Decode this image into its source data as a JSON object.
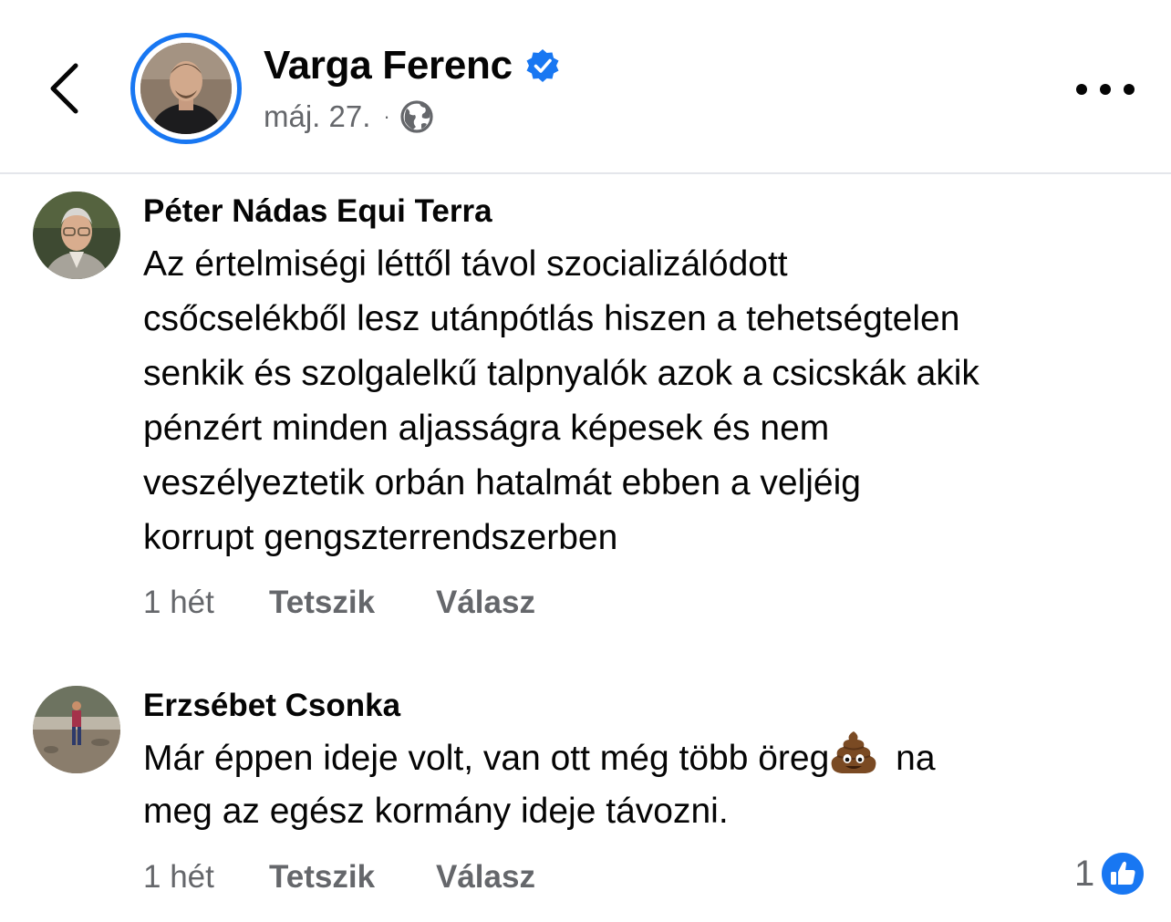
{
  "post": {
    "author_name": "Varga Ferenc",
    "date": "máj. 27.",
    "separator": "·"
  },
  "icons": {
    "back": "chevron-left-icon",
    "verified": "verified-badge-icon",
    "privacy": "globe-icon",
    "more": "more-horizontal-icon",
    "reaction": "like-thumb-icon",
    "emoji": "pile-of-poo-emoji"
  },
  "colors": {
    "accent": "#1877f2",
    "secondary_text": "#65676b",
    "divider": "#e4e6eb"
  },
  "comments": [
    {
      "author": "Péter Nádas Equi Terra",
      "lines": [
        "Az értelmiségi léttől távol szocializálódott",
        "csőcselékből lesz utánpótlás hiszen a tehetségtelen",
        "senkik és szolgalelkű talpnyalók azok a csicskák akik",
        "pénzért minden aljasságra képesek és nem",
        "veszélyeztetik orbán hatalmát ebben a veljéig",
        "korrupt gengszterrendszerben"
      ],
      "time": "1 hét",
      "like_label": "Tetszik",
      "reply_label": "Válasz"
    },
    {
      "author": "Erzsébet Csonka",
      "line1_before_emoji": "Már éppen ideje volt, van ott még több öreg",
      "line1_after_emoji": "na",
      "line2": "meg az egész kormány ideje távozni.",
      "time": "1 hét",
      "like_label": "Tetszik",
      "reply_label": "Válasz",
      "reaction_count": "1"
    }
  ]
}
